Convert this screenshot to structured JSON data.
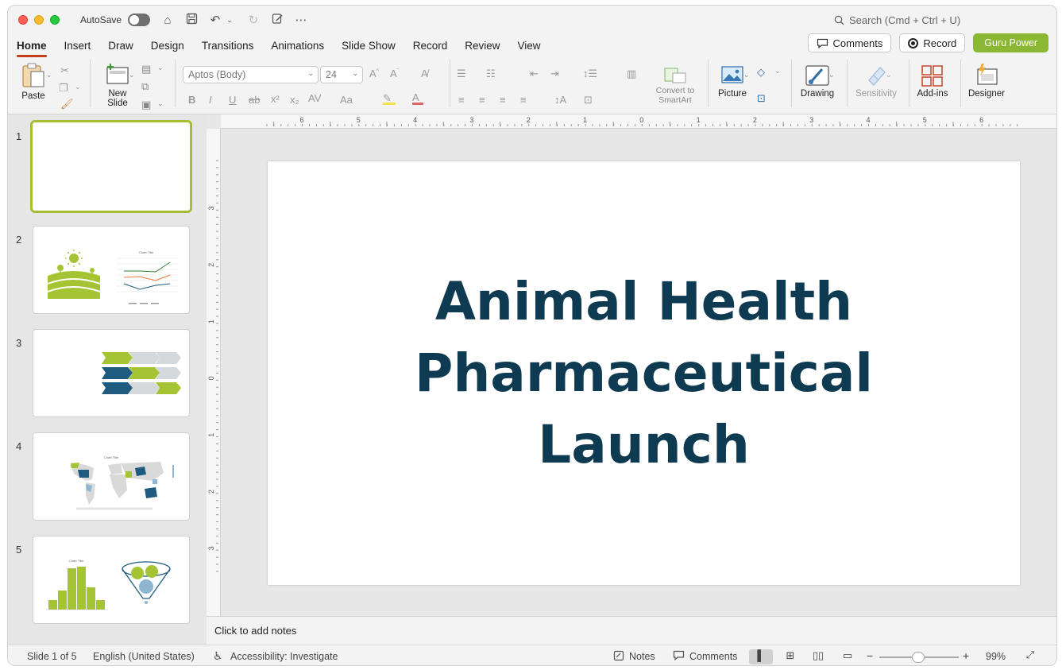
{
  "titlebar": {
    "autosave_label": "AutoSave",
    "search_placeholder": "Search (Cmd + Ctrl + U)"
  },
  "tabs": [
    {
      "label": "Home",
      "active": true
    },
    {
      "label": "Insert"
    },
    {
      "label": "Draw"
    },
    {
      "label": "Design"
    },
    {
      "label": "Transitions"
    },
    {
      "label": "Animations"
    },
    {
      "label": "Slide Show"
    },
    {
      "label": "Record"
    },
    {
      "label": "Review"
    },
    {
      "label": "View"
    }
  ],
  "header_buttons": {
    "comments": "Comments",
    "record": "Record",
    "guru": "Guru Power"
  },
  "ribbon": {
    "paste": "Paste",
    "new_slide_line1": "New",
    "new_slide_line2": "Slide",
    "font_name": "Aptos (Body)",
    "font_size": "24",
    "convert_line1": "Convert to",
    "convert_line2": "SmartArt",
    "picture": "Picture",
    "drawing": "Drawing",
    "sensitivity": "Sensitivity",
    "addins": "Add-ins",
    "designer": "Designer"
  },
  "thumbnails": [
    {
      "number": "1",
      "selected": true
    },
    {
      "number": "2",
      "chart_title": "Chart Title"
    },
    {
      "number": "3"
    },
    {
      "number": "4",
      "chart_title": "Chart Title"
    },
    {
      "number": "5",
      "chart_title": "Chart Title"
    }
  ],
  "ruler": {
    "h_ticks": [
      "6",
      "5",
      "4",
      "3",
      "2",
      "1",
      "0",
      "1",
      "2",
      "3",
      "4",
      "5",
      "6"
    ],
    "v_ticks": [
      "3",
      "2",
      "1",
      "0",
      "1",
      "2",
      "3"
    ]
  },
  "slide": {
    "title_line1": "Animal Health",
    "title_line2": "Pharmaceutical",
    "title_line3": "Launch"
  },
  "notes_placeholder": "Click to add notes",
  "status": {
    "slide_info": "Slide 1 of 5",
    "language": "English (United States)",
    "accessibility": "Accessibility: Investigate",
    "notes": "Notes",
    "comments": "Comments",
    "zoom": "99%"
  },
  "colors": {
    "title": "#0e3a52",
    "accent_green": "#8ab833",
    "tab_underline": "#c43e1c",
    "navy": "#1f5b7e"
  }
}
